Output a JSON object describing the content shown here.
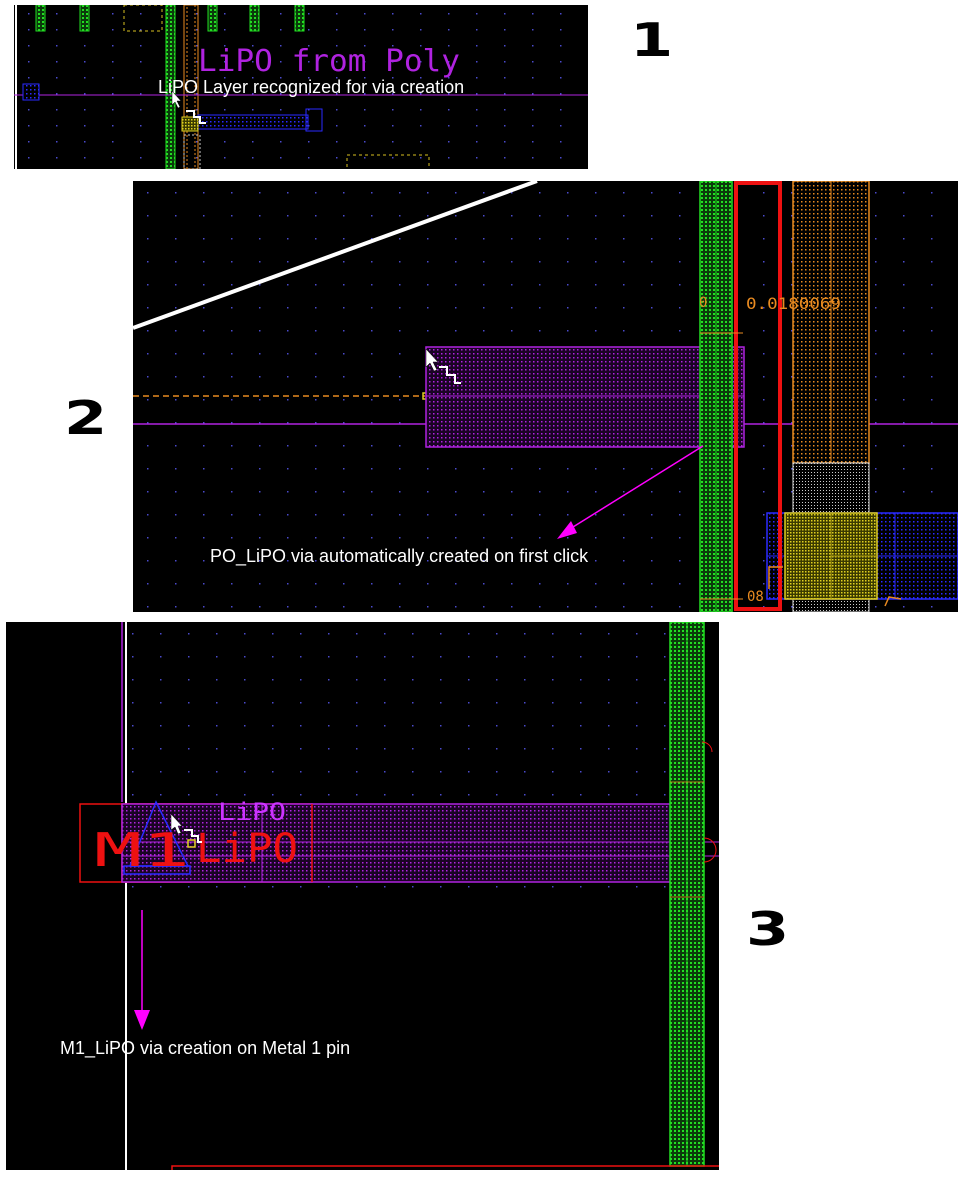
{
  "steps": [
    "1",
    "2",
    "3"
  ],
  "panel1": {
    "layout_label": "LiPO from Poly",
    "annotation": "LiPO Layer recognized for via creation"
  },
  "panel2": {
    "dimension_value": "0.0180069",
    "dimension_tick": "0",
    "dimension_small": "08",
    "annotation": "PO_LiPO via automatically created on first click"
  },
  "panel3": {
    "layer_label": "LiPO",
    "via_label_m1": "M1",
    "via_label_lipo": "LiPO",
    "annotation": "M1_LiPO via creation on Metal 1 pin"
  },
  "colors": {
    "canvas": "#000000",
    "poly_green": "#22dd22",
    "lipo_purple": "#b023e0",
    "metal_blue": "#2a2aff",
    "highlight_red": "#ee1111",
    "orange": "#e88a20",
    "yellow": "#d8d020",
    "arrow_magenta": "#ff00ff"
  },
  "icons": [
    "cursor-arrow-icon",
    "via-stair-icon"
  ]
}
